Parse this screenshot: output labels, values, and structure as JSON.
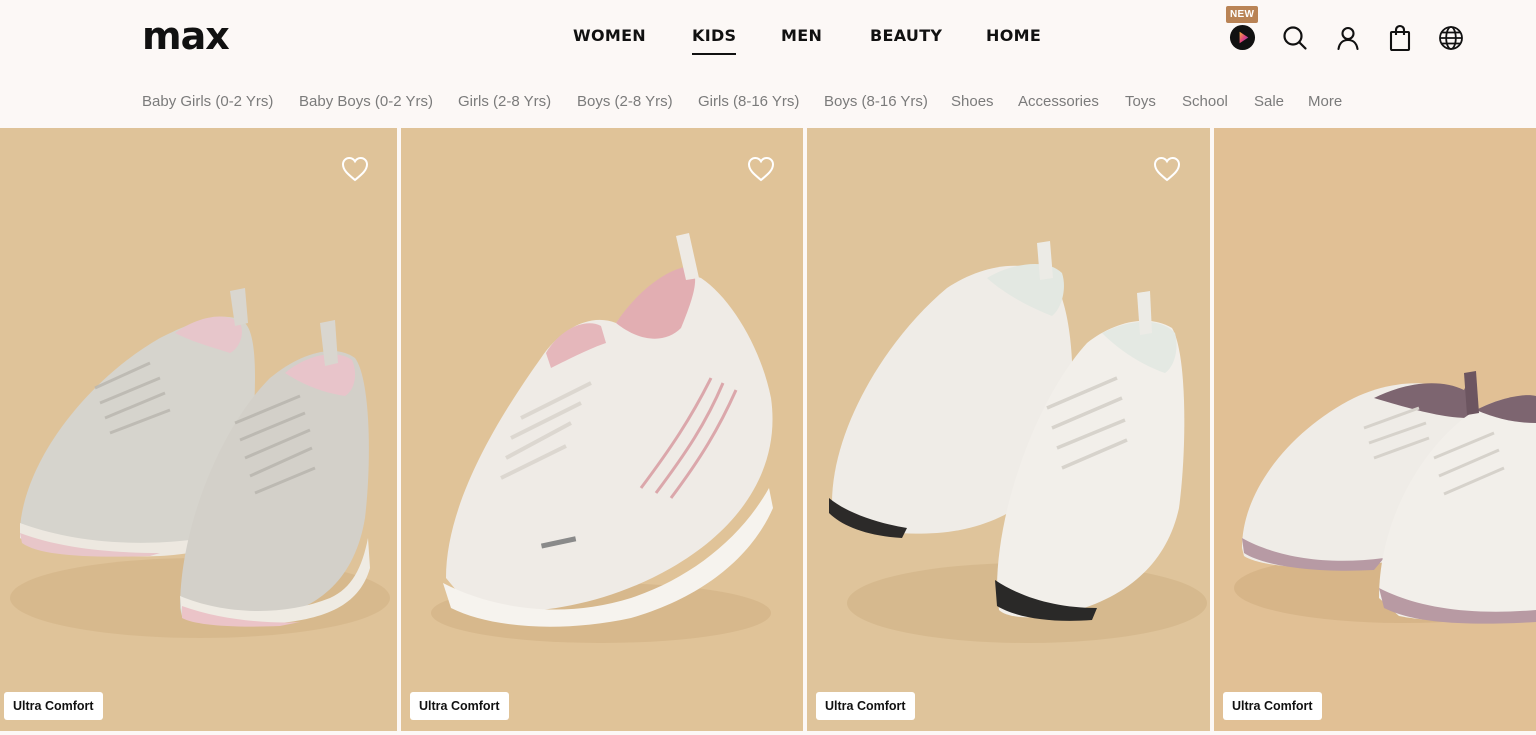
{
  "logo": "max",
  "main_nav": [
    "WOMEN",
    "KIDS",
    "MEN",
    "BEAUTY",
    "HOME"
  ],
  "main_nav_active": "KIDS",
  "new_badge": "NEW",
  "sub_nav": [
    "Baby Girls (0-2 Yrs)",
    "Baby Boys (0-2 Yrs)",
    "Girls (2-8 Yrs)",
    "Boys (2-8 Yrs)",
    "Girls (8-16 Yrs)",
    "Boys (8-16 Yrs)",
    "Shoes",
    "Accessories",
    "Toys",
    "School",
    "Sale",
    "More"
  ],
  "products": [
    {
      "tag": "Ultra Comfort",
      "image": "grey-pink-sneakers-pair"
    },
    {
      "tag": "Ultra Comfort",
      "image": "white-pink-running-shoe"
    },
    {
      "tag": "Ultra Comfort",
      "image": "white-sneakers-pair"
    },
    {
      "tag": "Ultra Comfort",
      "image": "white-mauve-sneakers-pair"
    }
  ],
  "colors": {
    "header_bg": "#fcf8f6",
    "card_bg": "#e2c49a",
    "badge": "#b98355",
    "subnav_text": "#7b7b7b"
  },
  "icons": [
    "play-video-icon",
    "search-icon",
    "account-icon",
    "shopping-bag-icon",
    "globe-icon",
    "heart-icon"
  ]
}
